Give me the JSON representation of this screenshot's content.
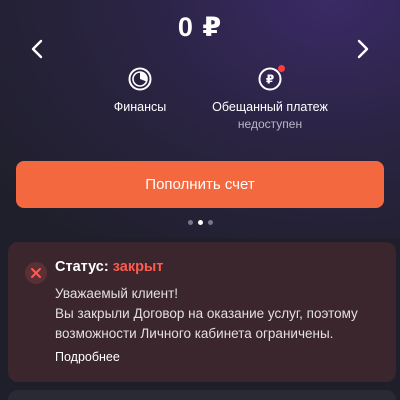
{
  "balance": {
    "amount": "0 ₽"
  },
  "nav": {
    "prev_icon": "chevron-left-icon",
    "next_icon": "chevron-right-icon"
  },
  "actions": [
    {
      "label": "Финансы",
      "icon": "pie-chart-icon"
    },
    {
      "label": "Обещанный платеж",
      "sublabel": "недоступен",
      "icon": "promise-payment-icon",
      "badge_color": "#ff3b3b"
    }
  ],
  "topup_button": {
    "label": "Пополнить счет",
    "color": "#f4683f"
  },
  "pager": {
    "count": 3,
    "active_index": 1
  },
  "status_card": {
    "status_prefix": "Статус:",
    "status_value": "закрыт",
    "status_color": "#ff5b4f",
    "greeting": "Уважаемый клиент!",
    "message": "Вы закрыли Договор на оказание услуг, поэтому возможности Личного кабинета ограничены.",
    "more_link": "Подробнее"
  }
}
